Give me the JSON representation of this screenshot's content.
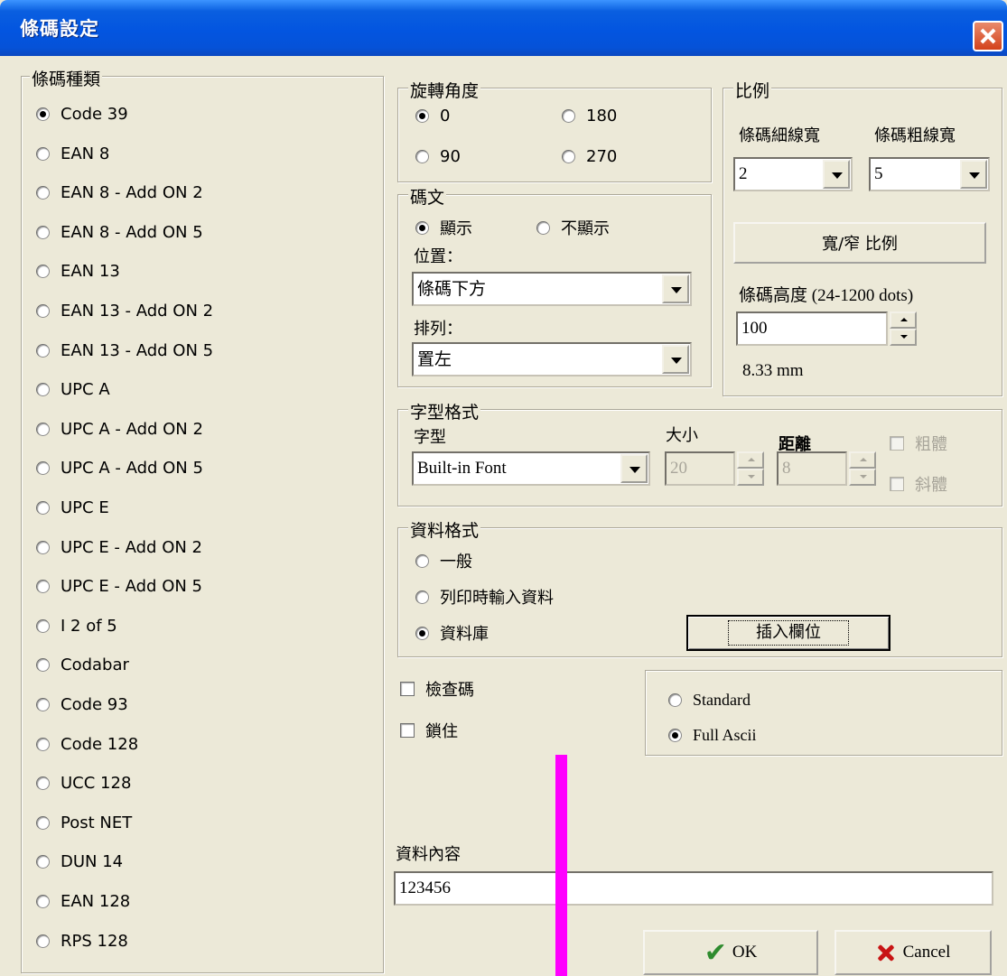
{
  "window": {
    "title": "條碼設定"
  },
  "barcode_type": {
    "legend": "條碼種類",
    "selected": "Code 39",
    "options": [
      "Code 39",
      "EAN 8",
      "EAN 8 - Add ON 2",
      "EAN 8 - Add ON 5",
      "EAN 13",
      "EAN 13 - Add ON 2",
      "EAN 13 - Add ON 5",
      "UPC A",
      "UPC A - Add ON 2",
      "UPC A - Add ON 5",
      "UPC E",
      "UPC E - Add ON 2",
      "UPC E - Add ON 5",
      "I 2 of 5",
      "Codabar",
      "Code 93",
      "Code 128",
      "UCC 128",
      "Post NET",
      "DUN 14",
      "EAN 128",
      "RPS 128"
    ]
  },
  "rotation": {
    "legend": "旋轉角度",
    "opt_0": "0",
    "opt_180": "180",
    "opt_90": "90",
    "opt_270": "270",
    "selected": "0"
  },
  "ratio": {
    "legend": "比例",
    "narrow_label": "條碼細線寬",
    "narrow_value": "2",
    "wide_label": "條碼粗線寬",
    "wide_value": "5",
    "ratio_button": "寬/窄 比例",
    "height_label": "條碼高度 (24-1200 dots)",
    "height_value": "100",
    "height_mm": "8.33 mm"
  },
  "text": {
    "legend": "碼文",
    "show": "顯示",
    "hide": "不顯示",
    "selected": "顯示",
    "position_label": "位置：",
    "position_value": "條碼下方",
    "align_label": "排列：",
    "align_value": "置左"
  },
  "font": {
    "legend": "字型格式",
    "font_label": "字型",
    "font_value": "Built-in Font",
    "size_label": "大小",
    "size_value": "20",
    "spacing_label": "距離",
    "spacing_value": "8",
    "bold": "粗體",
    "italic": "斜體"
  },
  "data_format": {
    "legend": "資料格式",
    "general": "一般",
    "prompt": "列印時輸入資料",
    "database": "資料庫",
    "selected": "資料庫",
    "insert_field": "插入欄位"
  },
  "checks": {
    "check_digit": "檢查碼",
    "lock": "鎖住"
  },
  "ascii": {
    "standard": "Standard",
    "full": "Full Ascii",
    "selected": "Full Ascii"
  },
  "content": {
    "label": "資料內容",
    "value": "123456"
  },
  "buttons": {
    "ok": "OK",
    "cancel": "Cancel"
  },
  "colors": {
    "titlebar": "#0355e0",
    "face": "#ece9d8",
    "marker": "#ff00ff"
  },
  "icons": {
    "close": "close-icon",
    "ok": "checkmark-icon",
    "cancel": "x-icon"
  }
}
